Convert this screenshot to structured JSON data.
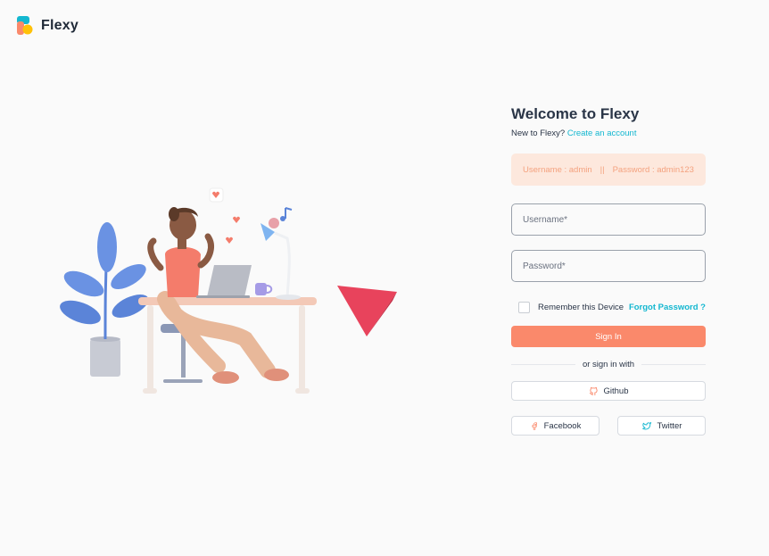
{
  "brand": {
    "name": "Flexy"
  },
  "login": {
    "title": "Welcome to Flexy",
    "new_prompt": "New to Flexy?",
    "create_link": "Create an account",
    "demo_username": "Username : admin",
    "demo_separator": "||",
    "demo_password": "Password : admin123",
    "username_placeholder": "Username*",
    "password_placeholder": "Password*",
    "remember_label": "Remember this Device",
    "remember_checked": false,
    "forgot_link": "Forgot Password ?",
    "signin_label": "Sign In",
    "divider_text": "or sign in with",
    "github_label": "Github",
    "facebook_label": "Facebook",
    "twitter_label": "Twitter"
  },
  "icons": {
    "github": "github-icon",
    "facebook": "facebook-icon",
    "twitter": "twitter-icon"
  },
  "colors": {
    "primary": "#fa896b",
    "link": "#13b7d0",
    "alert_bg": "#fde8dd",
    "alert_text": "#f4a27f",
    "text": "#2a3547"
  }
}
